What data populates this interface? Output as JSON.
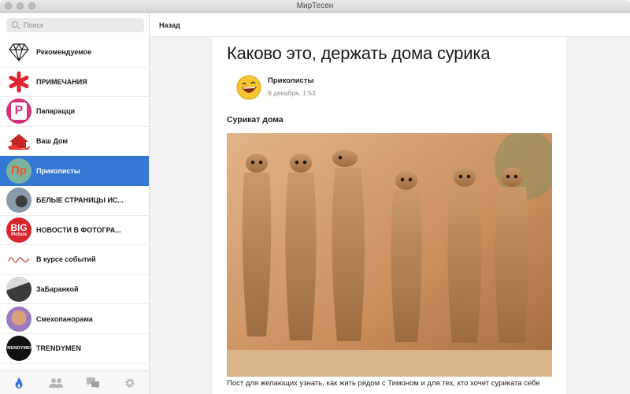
{
  "window": {
    "title": "МирТесен"
  },
  "search": {
    "placeholder": "Поиск"
  },
  "sidebar": {
    "items": [
      {
        "label": "Рекомендуемое",
        "icon": "diamond-icon"
      },
      {
        "label": "ПРИМЕЧАНИЯ",
        "icon": "asterisk-icon"
      },
      {
        "label": "Папарацци",
        "icon": "p-logo-icon"
      },
      {
        "label": "Ваш Дом",
        "icon": "house-icon"
      },
      {
        "label": "Приколисты",
        "icon": "pr-logo-icon",
        "active": true
      },
      {
        "label": "БЕЛЫЕ СТРАНИЦЫ ИС...",
        "icon": "avatar"
      },
      {
        "label": "НОВОСТИ В ФОТОГРА...",
        "icon": "big-picture-logo"
      },
      {
        "label": "В курсе событий",
        "icon": "script-logo"
      },
      {
        "label": "ЗаБаранкой",
        "icon": "car-avatar"
      },
      {
        "label": "Смехопанорама",
        "icon": "comedian-avatar"
      },
      {
        "label": "TRENDYMEN",
        "icon": "trendymen-logo"
      }
    ],
    "logos": {
      "big": "BIG",
      "picture": "Picture",
      "trendymen": "TRENDYMEN",
      "p": "P",
      "pr": "Пр"
    }
  },
  "bottom_bar": [
    "fire-icon",
    "people-icon",
    "chat-icon",
    "gear-icon"
  ],
  "navbar": {
    "back_label": "Назад"
  },
  "article": {
    "title": "Каково это, держать дома сурика",
    "author": "Приколисты",
    "date": "9 декабря, 1:53",
    "subheading": "Сурикат дома",
    "caption": "Пост для желающих узнать, как жить рядом с Тимоном и для тех, кто хочет суриката себе"
  },
  "colors": {
    "accent": "#3478d4",
    "sidebar_bg": "#ffffff",
    "content_bg": "#f2f2f2"
  }
}
